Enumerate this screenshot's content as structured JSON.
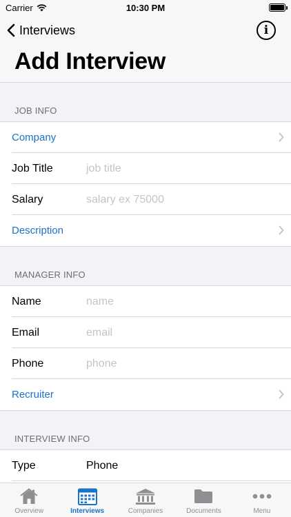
{
  "status_bar": {
    "carrier": "Carrier",
    "time": "10:30 PM"
  },
  "nav": {
    "back_label": "Interviews",
    "title": "Add Interview"
  },
  "sections": {
    "job_info": {
      "header": "JOB INFO",
      "company_label": "Company",
      "job_title_label": "Job Title",
      "job_title_placeholder": "job title",
      "salary_label": "Salary",
      "salary_placeholder": "salary ex 75000",
      "description_label": "Description"
    },
    "manager_info": {
      "header": "MANAGER INFO",
      "name_label": "Name",
      "name_placeholder": "name",
      "email_label": "Email",
      "email_placeholder": "email",
      "phone_label": "Phone",
      "phone_placeholder": "phone",
      "recruiter_label": "Recruiter"
    },
    "interview_info": {
      "header": "INTERVIEW INFO",
      "type_label": "Type",
      "type_value": "Phone"
    }
  },
  "tabs": [
    {
      "label": "Overview",
      "icon": "home-icon",
      "active": false
    },
    {
      "label": "Interviews",
      "icon": "calendar-icon",
      "active": true
    },
    {
      "label": "Companies",
      "icon": "bank-icon",
      "active": false
    },
    {
      "label": "Documents",
      "icon": "folder-icon",
      "active": false
    },
    {
      "label": "Menu",
      "icon": "more-icon",
      "active": false
    }
  ],
  "colors": {
    "accent": "#1a73c8",
    "placeholder": "#c4c4c7",
    "background": "#f2f2f7"
  }
}
